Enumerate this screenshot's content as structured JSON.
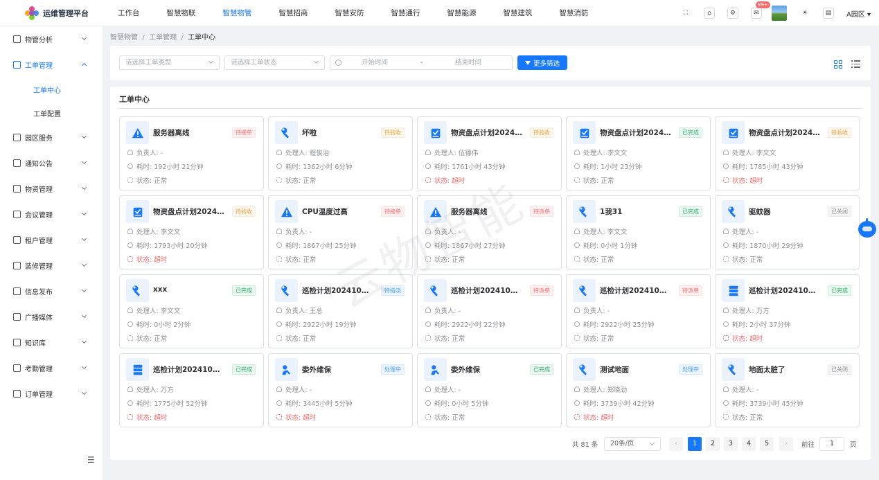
{
  "app": {
    "title": "运维管理平台",
    "park": "A园区"
  },
  "topnav": [
    {
      "label": "工作台",
      "active": false
    },
    {
      "label": "智慧物联",
      "active": false
    },
    {
      "label": "智慧物管",
      "active": true
    },
    {
      "label": "智慧招商",
      "active": false
    },
    {
      "label": "智慧安防",
      "active": false
    },
    {
      "label": "智慧通行",
      "active": false
    },
    {
      "label": "智慧能源",
      "active": false
    },
    {
      "label": "智慧建筑",
      "active": false
    },
    {
      "label": "智慧消防",
      "active": false
    }
  ],
  "header": {
    "mail_badge": "99+"
  },
  "sidebar": {
    "items": [
      {
        "label": "物管分析",
        "icon": "chart-icon"
      },
      {
        "label": "工单管理",
        "icon": "clipboard-icon",
        "open": true,
        "children": [
          {
            "label": "工单中心",
            "active": true
          },
          {
            "label": "工单配置",
            "active": false
          }
        ]
      },
      {
        "label": "园区服务",
        "icon": "service-icon"
      },
      {
        "label": "通知公告",
        "icon": "notice-icon"
      },
      {
        "label": "物资管理",
        "icon": "materials-icon"
      },
      {
        "label": "会议管理",
        "icon": "meeting-icon"
      },
      {
        "label": "租户管理",
        "icon": "tenant-icon"
      },
      {
        "label": "装修管理",
        "icon": "renovation-icon"
      },
      {
        "label": "信息发布",
        "icon": "publish-icon"
      },
      {
        "label": "广播媒体",
        "icon": "broadcast-icon"
      },
      {
        "label": "知识库",
        "icon": "knowledge-icon"
      },
      {
        "label": "考勤管理",
        "icon": "attendance-icon"
      },
      {
        "label": "订单管理",
        "icon": "order-icon"
      }
    ]
  },
  "breadcrumb": {
    "l1": "智慧物管",
    "l2": "工单管理",
    "l3": "工单中心",
    "sep": "/"
  },
  "filters": {
    "type_placeholder": "请选择工单类型",
    "status_placeholder": "请选择工单状态",
    "start_placeholder": "开始时间",
    "sep": "-",
    "end_placeholder": "结束时间",
    "more_label": "更多筛选"
  },
  "panel": {
    "title": "工单中心"
  },
  "watermark": "云物智能",
  "cards": [
    {
      "title": "服务器离线",
      "status": "待接单",
      "tone": "pend",
      "icon": "warning-icon",
      "person": "负责人: -",
      "time": "耗时: 192小时 21分钟",
      "state": "状态: 正常",
      "bad": false
    },
    {
      "title": "坏啦",
      "status": "待验收",
      "tone": "wait",
      "icon": "wrench-icon",
      "person": "处理人: 程俊治",
      "time": "耗时: 1362小时 6分钟",
      "state": "状态: 正常",
      "bad": false
    },
    {
      "title": "物资盘点计划2024…",
      "status": "待验收",
      "tone": "wait",
      "icon": "checklist-icon",
      "person": "处理人: 伍德伟",
      "time": "耗时: 1761小时 43分钟",
      "state": "状态: 超时",
      "bad": true
    },
    {
      "title": "物资盘点计划2024…",
      "status": "已完成",
      "tone": "done",
      "icon": "checklist-icon",
      "person": "处理人: 李文文",
      "time": "耗时: 1小时 23分钟",
      "state": "状态: 正常",
      "bad": false
    },
    {
      "title": "物资盘点计划2024…",
      "status": "待验收",
      "tone": "wait",
      "icon": "checklist-icon",
      "person": "处理人: 李文文",
      "time": "耗时: 1785小时 43分钟",
      "state": "状态: 超时",
      "bad": true
    },
    {
      "title": "物资盘点计划2024…",
      "status": "待验收",
      "tone": "wait",
      "icon": "checklist-icon",
      "person": "处理人: 李文文",
      "time": "耗时: 1793小时 20分钟",
      "state": "状态: 超时",
      "bad": true
    },
    {
      "title": "CPU温度过高",
      "status": "待接单",
      "tone": "pend",
      "icon": "warning-icon",
      "person": "负责人: -",
      "time": "耗时: 1867小时 25分钟",
      "state": "状态: 正常",
      "bad": false
    },
    {
      "title": "服务器离线",
      "status": "待派单",
      "tone": "pend",
      "icon": "warning-icon",
      "person": "负责人: -",
      "time": "耗时: 1867小时 27分钟",
      "state": "状态: 正常",
      "bad": false
    },
    {
      "title": "1我31",
      "status": "已完成",
      "tone": "done",
      "icon": "wrench-icon",
      "person": "处理人: 李文文",
      "time": "耗时: 0小时 1分钟",
      "state": "状态: 正常",
      "bad": false
    },
    {
      "title": "驱蚊器",
      "status": "已关闭",
      "tone": "close",
      "icon": "wrench-icon",
      "person": "处理人: -",
      "time": "耗时: 1870小时 29分钟",
      "state": "状态: 正常",
      "bad": false
    },
    {
      "title": "xxx",
      "status": "已完成",
      "tone": "done",
      "icon": "wrench-icon",
      "person": "处理人: 李文文",
      "time": "耗时: 0小时 2分钟",
      "state": "状态: 正常",
      "bad": false
    },
    {
      "title": "巡检计划202410…",
      "status": "待指派",
      "tone": "proc",
      "icon": "wrench-icon",
      "person": "负责人: 王总",
      "time": "耗时: 2922小时 19分钟",
      "state": "状态: 正常",
      "bad": false
    },
    {
      "title": "巡检计划202410…",
      "status": "待派单",
      "tone": "pend",
      "icon": "wrench-icon",
      "person": "负责人: -",
      "time": "耗时: 2922小时 22分钟",
      "state": "状态: 正常",
      "bad": false
    },
    {
      "title": "巡检计划202410…",
      "status": "待派单",
      "tone": "pend",
      "icon": "wrench-icon",
      "person": "负责人: -",
      "time": "耗时: 2922小时 25分钟",
      "state": "状态: 正常",
      "bad": false
    },
    {
      "title": "巡检计划202410…",
      "status": "已完成",
      "tone": "done",
      "icon": "server-icon",
      "person": "处理人: 万方",
      "time": "耗时: 2小时 37分钟",
      "state": "状态: 超时",
      "bad": true
    },
    {
      "title": "巡检计划202410…",
      "status": "已完成",
      "tone": "done",
      "icon": "server-icon",
      "person": "处理人: 万方",
      "time": "耗时: 1775小时 52分钟",
      "state": "状态: 超时",
      "bad": true
    },
    {
      "title": "委外维保",
      "status": "处理中",
      "tone": "proc",
      "icon": "outsource-icon",
      "person": "处理人: -",
      "time": "耗时: 3445小时 5分钟",
      "state": "状态: 超时",
      "bad": true
    },
    {
      "title": "委外维保",
      "status": "已完成",
      "tone": "done",
      "icon": "outsource-icon",
      "person": "处理人: -",
      "time": "耗时: 0小时 5分钟",
      "state": "状态: 正常",
      "bad": false
    },
    {
      "title": "测试地面",
      "status": "处理中",
      "tone": "proc",
      "icon": "wrench-icon",
      "person": "处理人: 郑晓劲",
      "time": "耗时: 3739小时 42分钟",
      "state": "状态: 超时",
      "bad": true
    },
    {
      "title": "地面太脏了",
      "status": "已关闭",
      "tone": "close",
      "icon": "wrench-icon",
      "person": "处理人: -",
      "time": "耗时: 3739小时 45分钟",
      "state": "状态: 正常",
      "bad": false
    }
  ],
  "pagination": {
    "total": "共 81 条",
    "page_size": "20条/页",
    "pages": [
      "1",
      "2",
      "3",
      "4",
      "5"
    ],
    "active_page": "1",
    "prev": "‹",
    "next": "›",
    "goto_label": "前往",
    "goto_value": "1",
    "goto_unit": "页"
  }
}
